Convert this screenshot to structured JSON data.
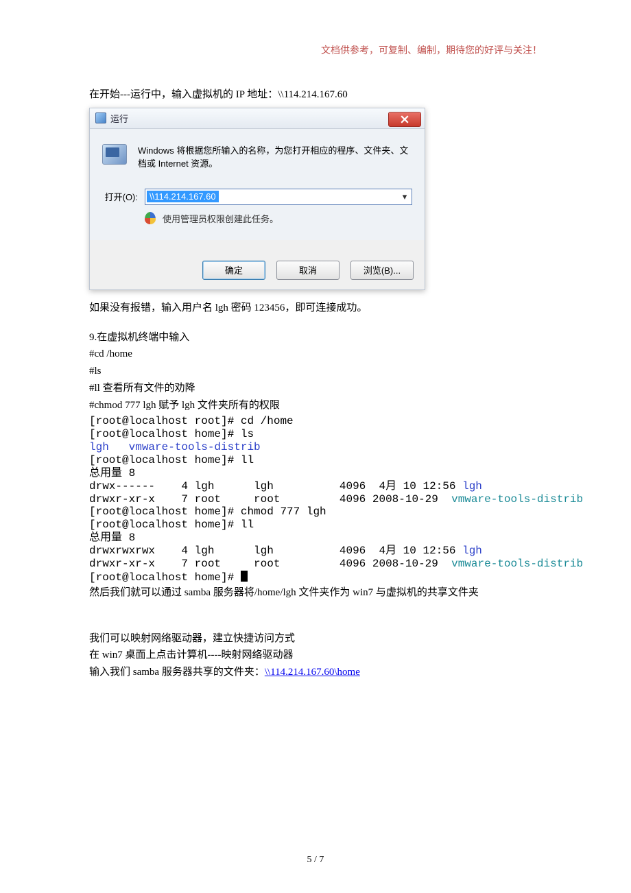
{
  "header": {
    "note": "文档供参考，可复制、编制，期待您的好评与关注！"
  },
  "intro": "在开始---运行中，输入虚拟机的 IP 地址：\\\\114.214.167.60",
  "dialog": {
    "title": "运行",
    "description": "Windows 将根据您所输入的名称，为您打开相应的程序、文件夹、文档或 Internet 资源。",
    "open_label": "打开(O):",
    "open_value": "\\\\114.214.167.60",
    "shield_text": "使用管理员权限创建此任务。",
    "buttons": {
      "ok": "确定",
      "cancel": "取消",
      "browse": "浏览(B)..."
    }
  },
  "after_dialog": "如果没有报错，输入用户名 lgh  密码 123456，即可连接成功。",
  "section9": {
    "heading": "9.在虚拟机终端中输入",
    "cmd_cd": "#cd    /home",
    "cmd_ls": "#ls",
    "cmd_ll": "#ll        查看所有文件的劝降",
    "cmd_chmod": "#chmod   777   lgh        赋予 lgh 文件夹所有的权限"
  },
  "terminal": {
    "line1_a": "[root@localhost root]# cd /home",
    "line2_a": "[root@localhost home]# ls",
    "line3_blue": "lgh   vmware-tools-distrib",
    "line4_a": "[root@localhost home]# ll",
    "total1": "总用量 8",
    "r1_a": "drwx------    4 lgh      lgh          4096  4月 10 12:56 ",
    "r1_b": "lgh",
    "r2_a": "drwxr-xr-x    7 root     root         4096 2008-10-29  ",
    "r2_b": "vmware-tools-distrib",
    "line7_a": "[root@localhost home]# chmod 777 lgh",
    "line8_a": "[root@localhost home]# ll",
    "total2": "总用量 8",
    "r3_a": "drwxrwxrwx    4 lgh      lgh          4096  4月 10 12:56 ",
    "r3_b": "lgh",
    "r4_a": "drwxr-xr-x    7 root     root         4096 2008-10-29  ",
    "r4_b": "vmware-tools-distrib",
    "prompt_end": "[root@localhost home]# "
  },
  "post_term": "然后我们就可以通过 samba 服务器将/home/lgh 文件夹作为 win7 与虚拟机的共享文件夹",
  "tail": {
    "l1": "我们可以映射网络驱动器，建立快捷访问方式",
    "l2": "在 win7 桌面上点击计算机----映射网络驱动器",
    "l3_a": "输入我们 samba 服务器共享的文件夹：",
    "l3_link": "\\\\114.214.167.60\\home"
  },
  "footer": "5  /  7"
}
